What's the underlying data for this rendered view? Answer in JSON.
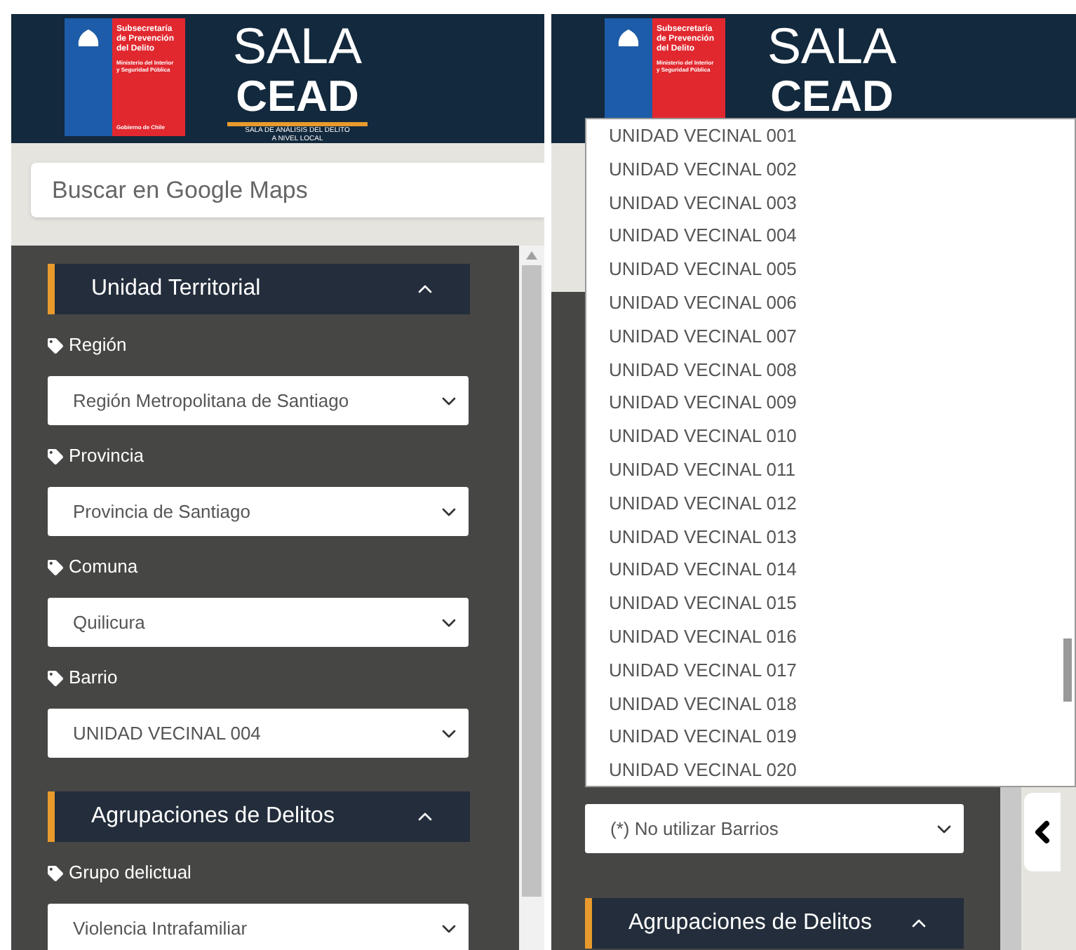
{
  "panels": [
    {
      "header": {
        "agency": [
          "Subsecretaría",
          "de Prevención",
          "del Delito"
        ],
        "ministry": [
          "Ministerio del Interior",
          "y Seguridad Pública"
        ],
        "government": "Gobierno de Chile",
        "title_top": "SALA",
        "title_bottom": "CEAD",
        "subtitle": [
          "SALA DE ANÁLISIS DEL DELITO",
          "A NIVEL LOCAL"
        ]
      },
      "search": {
        "placeholder": "Buscar en Google Maps"
      },
      "sections": [
        {
          "title": "Unidad Territorial",
          "expanded": true,
          "fields": [
            {
              "label": "Región",
              "value": "Región Metropolitana de Santiago"
            },
            {
              "label": "Provincia",
              "value": "Provincia de Santiago"
            },
            {
              "label": "Comuna",
              "value": "Quilicura"
            },
            {
              "label": "Barrio",
              "value": "UNIDAD VECINAL 004"
            }
          ]
        },
        {
          "title": "Agrupaciones de Delitos",
          "expanded": true,
          "fields": [
            {
              "label": "Grupo delictual",
              "value": "Violencia Intrafamiliar"
            }
          ]
        }
      ]
    },
    {
      "header": {
        "agency": [
          "Subsecretaría",
          "de Prevención",
          "del Delito"
        ],
        "ministry": [
          "Ministerio del Interior",
          "y Seguridad Pública"
        ],
        "title_top": "SALA",
        "title_bottom": "CEAD"
      },
      "dropdown": {
        "options": [
          "UNIDAD VECINAL 001",
          "UNIDAD VECINAL 002",
          "UNIDAD VECINAL 003",
          "UNIDAD VECINAL 004",
          "UNIDAD VECINAL 005",
          "UNIDAD VECINAL 006",
          "UNIDAD VECINAL 007",
          "UNIDAD VECINAL 008",
          "UNIDAD VECINAL 009",
          "UNIDAD VECINAL 010",
          "UNIDAD VECINAL 011",
          "UNIDAD VECINAL 012",
          "UNIDAD VECINAL 013",
          "UNIDAD VECINAL 014",
          "UNIDAD VECINAL 015",
          "UNIDAD VECINAL 016",
          "UNIDAD VECINAL 017",
          "UNIDAD VECINAL 018",
          "UNIDAD VECINAL 019",
          "UNIDAD VECINAL 020"
        ]
      },
      "select": {
        "value": "(*) No utilizar Barrios"
      },
      "sections": [
        {
          "title": "Agrupaciones de Delitos",
          "expanded": true
        }
      ]
    }
  ]
}
